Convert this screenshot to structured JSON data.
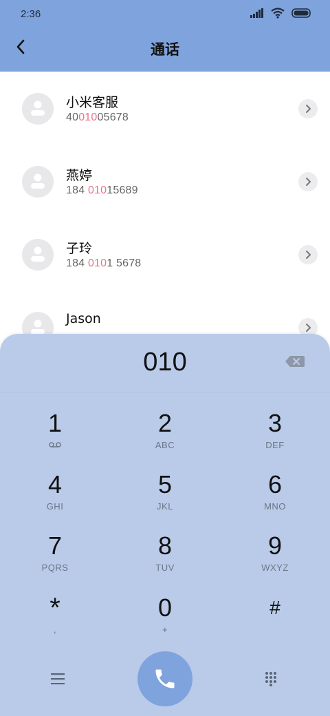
{
  "status": {
    "time": "2:36"
  },
  "header": {
    "title": "通话"
  },
  "contacts": [
    {
      "name": "小米客服",
      "number_pre": "40",
      "number_hl": "010",
      "number_post": "05678"
    },
    {
      "name": "燕婷",
      "number_pre": "184 ",
      "number_hl": "010",
      "number_post": "15689"
    },
    {
      "name": "子玲",
      "number_pre": "184 ",
      "number_hl": "010",
      "number_post": "1 5678"
    },
    {
      "name": "Jason",
      "number_pre": "",
      "number_hl": "",
      "number_post": ""
    }
  ],
  "dialpad": {
    "entered": "010",
    "keys": [
      {
        "digit": "1",
        "letters": ""
      },
      {
        "digit": "2",
        "letters": "ABC"
      },
      {
        "digit": "3",
        "letters": "DEF"
      },
      {
        "digit": "4",
        "letters": "GHI"
      },
      {
        "digit": "5",
        "letters": "JKL"
      },
      {
        "digit": "6",
        "letters": "MNO"
      },
      {
        "digit": "7",
        "letters": "PQRS"
      },
      {
        "digit": "8",
        "letters": "TUV"
      },
      {
        "digit": "9",
        "letters": "WXYZ"
      },
      {
        "digit": "*",
        "letters": ","
      },
      {
        "digit": "0",
        "letters": "+"
      },
      {
        "digit": "#",
        "letters": ""
      }
    ]
  },
  "colors": {
    "accent": "#7fa3dc",
    "pad": "#b9cbe9",
    "highlight": "#e8758a"
  }
}
